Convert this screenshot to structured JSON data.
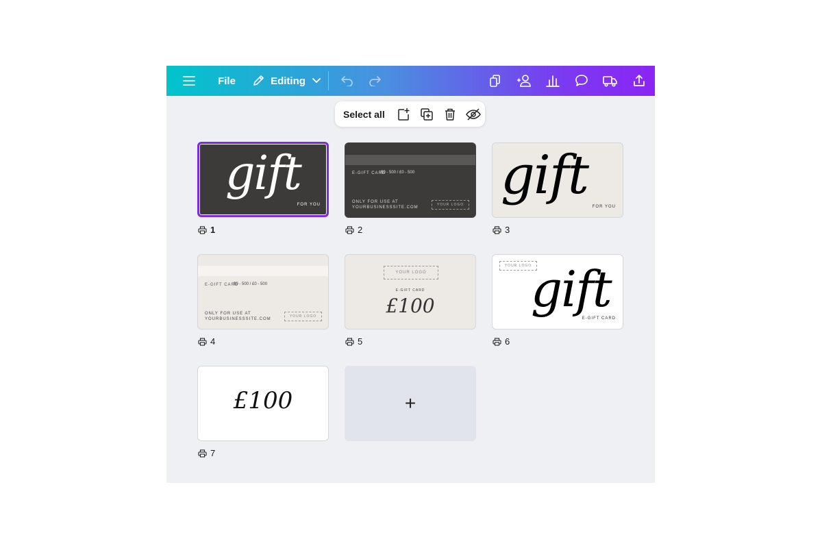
{
  "topbar": {
    "file_label": "File",
    "mode_label": "Editing"
  },
  "toolbar": {
    "select_all_label": "Select all"
  },
  "pages": [
    {
      "number": "1",
      "script": "gift",
      "caption": "FOR YOU"
    },
    {
      "number": "2",
      "egift": "E-gift card",
      "values": "$0 - 500 / £0 - 500",
      "use_line1": "Only for use at",
      "use_line2": "yourbusinesssite.com",
      "logo": "YOUR LOGO"
    },
    {
      "number": "3",
      "script": "gift",
      "caption": "FOR YOU"
    },
    {
      "number": "4",
      "egift": "E-gift card",
      "values": "$0 - 500 / £0 - 500",
      "use_line1": "Only for use at",
      "use_line2": "yourbusinesssite.com",
      "logo": "YOUR LOGO"
    },
    {
      "number": "5",
      "logo": "YOUR LOGO",
      "egift": "E-gift card",
      "amount": "£100"
    },
    {
      "number": "6",
      "logo": "YOUR LOGO",
      "script": "gift",
      "caption": "E-gift card"
    },
    {
      "number": "7",
      "amount": "£100"
    }
  ],
  "add_page": {
    "symbol": "+"
  },
  "colors": {
    "accent_purple": "#7d2ae8",
    "gradient_start": "#00c4cc",
    "gradient_end": "#8b24f5",
    "dark_card": "#3d3b3a",
    "cream_card": "#ede9e5"
  },
  "icons": [
    "menu-icon",
    "pencil-icon",
    "chevron-down-icon",
    "undo-icon",
    "redo-icon",
    "copy-icon",
    "people-icon",
    "chart-icon",
    "comment-icon",
    "truck-icon",
    "share-icon",
    "add-page-icon",
    "duplicate-icon",
    "trash-icon",
    "hide-icon",
    "printer-icon"
  ]
}
